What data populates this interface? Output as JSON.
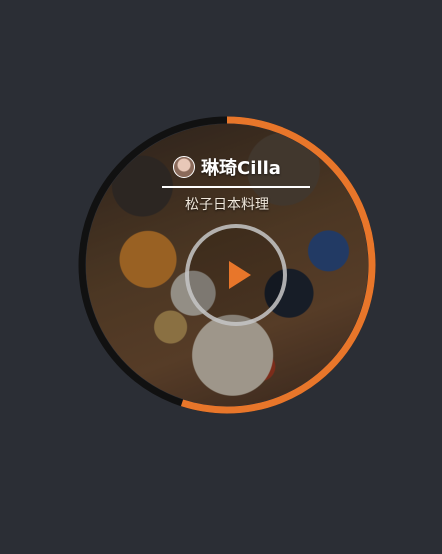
{
  "player": {
    "singer": "琳琦Cilla",
    "song": "松子日本料理",
    "progress": 0.55,
    "accent_color": "#e8762a",
    "track_color": "#111111",
    "icons": {
      "avatar": "singer-avatar",
      "play": "play-icon"
    }
  }
}
